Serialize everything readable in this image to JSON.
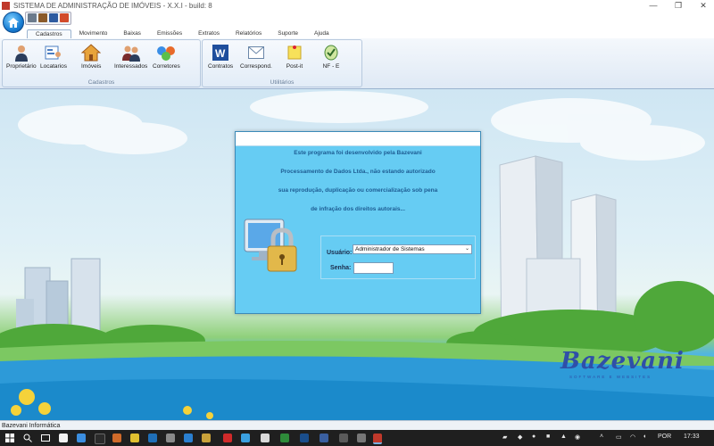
{
  "window": {
    "title": "SISTEMA DE ADMINISTRAÇÃO DE IMÓVEIS - X.X.I - build: 8",
    "min_glyph": "—",
    "restore_glyph": "❐",
    "close_glyph": "✕"
  },
  "ribbon": {
    "tabs": [
      "Cadastros",
      "Movimento",
      "Baixas",
      "Emissões",
      "Extratos",
      "Relatórios",
      "Suporte",
      "Ajuda"
    ],
    "active_tab": "Cadastros",
    "groups": {
      "cadastros": {
        "label": "Cadastros",
        "buttons": [
          "Proprietário",
          "Locatarios",
          "Imóveis",
          "Interessados",
          "Corretores"
        ]
      },
      "utilitarios": {
        "label": "Utilitários",
        "buttons": [
          "Contratos",
          "Correspond.",
          "Post-it",
          "NF - E"
        ]
      }
    }
  },
  "login": {
    "notice": [
      "Este programa foi desenvolvido pela Bazevani",
      "Processamento de Dados Ltda., não estando autorizado",
      "sua reprodução, duplicação ou comercialização sob pena",
      "de infração dos direitos autorais..."
    ],
    "user_label": "Usuário:",
    "user_value": "Administrador de Sistemas",
    "password_label": "Senha:"
  },
  "brand": {
    "name": "Bazevani",
    "tagline": "SOFTWARE E WEBSITES",
    "color": "#2f4fa8"
  },
  "statusbar": {
    "text": "Bazevani Informática"
  },
  "taskbar": {
    "language": "POR",
    "time": "17:33"
  },
  "colors": {
    "dialog_bg": "#66ccf3",
    "notice_text": "#1d5c93",
    "ribbon_border": "#9bb3cf"
  }
}
